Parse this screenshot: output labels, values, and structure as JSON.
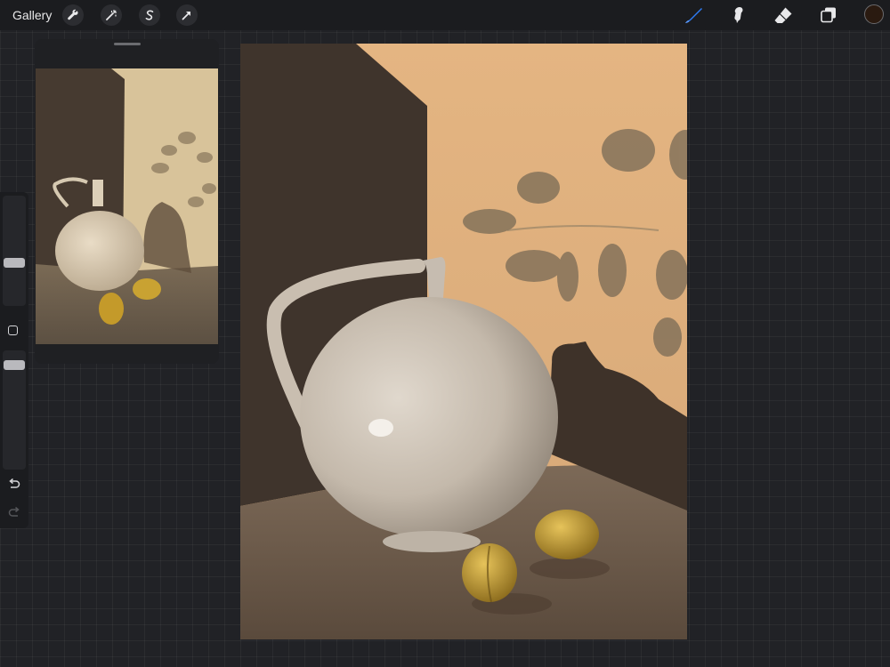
{
  "topbar": {
    "gallery_label": "Gallery",
    "left_icons": [
      "wrench-icon",
      "magic-wand-icon",
      "selection-s-icon",
      "transform-arrow-icon"
    ],
    "tools": [
      "brush-icon",
      "smudge-icon",
      "eraser-icon",
      "layers-icon"
    ],
    "active_tool": "brush-icon",
    "accent_color": "#2e7cf6",
    "current_color": "#2a1a10"
  },
  "sidebar": {
    "brush_size_level": 0.62,
    "opacity_level": 0.9,
    "controls": [
      "modify-button",
      "undo-icon",
      "redo-icon"
    ]
  },
  "reference": {
    "title_visible": false
  },
  "canvas": {
    "background_color": "#e2b07e",
    "subject": "vase-still-life"
  }
}
